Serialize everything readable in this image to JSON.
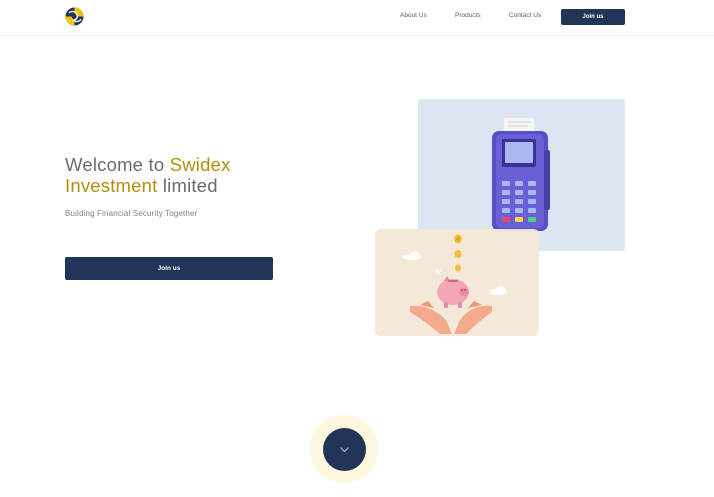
{
  "header": {
    "nav": {
      "about": "About Us",
      "products": "Products",
      "contact": "Contact Us"
    },
    "join_label": "Join us"
  },
  "hero": {
    "title_prefix": "Welcome to ",
    "title_brand": "Swidex",
    "title_brand2": "Investment",
    "title_suffix": " limited",
    "subtitle": "Building Financial Security Together",
    "join_label": "Join us"
  },
  "icons": {
    "logo": "swidex-logo",
    "scroll": "chevron-down-icon"
  },
  "colors": {
    "primary": "#213558",
    "accent": "#b0900e",
    "scroll_ring": "#fff8de",
    "card_blue": "#dce5f2",
    "card_beige": "#f3e8d6"
  }
}
